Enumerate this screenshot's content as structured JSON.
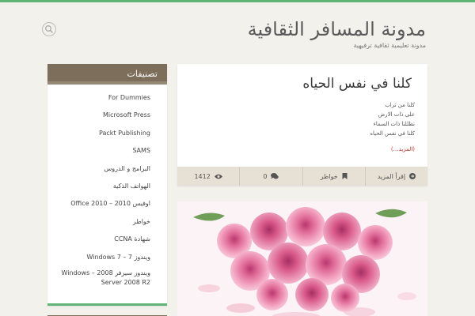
{
  "header": {
    "site_title": "مدونة المسافر الثقافية",
    "tagline": "مدونة تعليمية ثقافية ترفيهية"
  },
  "sidebar": {
    "heading": "تصنيفات",
    "categories": [
      "For Dummies",
      "Microsoft Press",
      "Packt Publishing",
      "SAMS",
      "البرامج و الدروس",
      "الهواتف الذكية",
      "اوفيس 2010 – Office 2010",
      "خواطر",
      "شهادة CCNA",
      "ويندوز 7 – Windows 7",
      "ويندوز سيرفر 2008 – Windows Server 2008 R2"
    ]
  },
  "post": {
    "title": "كلنا في نفس الحياه",
    "lines": [
      "كلنا من تراب",
      "على ذات الارض",
      "تظللنا ذات السماء",
      "كلنا في نفس الحياه"
    ],
    "more_link": "(المزيد…)",
    "meta": {
      "read_more": "إقرأ المزيد",
      "category": "خواطر",
      "comments": "0",
      "views": "1412"
    }
  },
  "colors": {
    "accent_green": "#5fb573",
    "sidebar_head": "#7d6e5c",
    "meta_bar": "#e7e1d5",
    "link_red": "#c0392b"
  },
  "icons": [
    "search-icon",
    "arrow-circle-icon",
    "bookmark-icon",
    "comments-icon",
    "eye-icon"
  ]
}
